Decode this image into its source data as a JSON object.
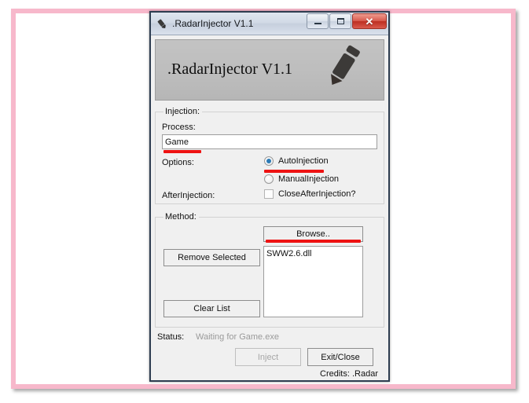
{
  "window": {
    "title": ".RadarInjector V1.1",
    "title_icon": "pencil-icon",
    "minimize_label": "–",
    "maximize_label": "□",
    "close_label": "✕"
  },
  "header": {
    "product_title": ".RadarInjector V1.1",
    "art": "pencil-illustration"
  },
  "injection_group": {
    "legend": "Injection:",
    "process_label": "Process:",
    "process_value": "Game",
    "process_placeholder": "",
    "options_label": "Options:",
    "radio_auto": "AutoInjection",
    "radio_manual": "ManualInjection",
    "radio_selected": "AutoInjection",
    "after_injection_label": "AfterInjection:",
    "checkbox_close": "CloseAfterInjection?",
    "checkbox_close_checked": false
  },
  "method_group": {
    "legend": "Method:",
    "browse_label": "Browse..",
    "remove_selected_label": "Remove Selected",
    "clear_list_label": "Clear List",
    "dll_list": [
      "SWW2.6.dll"
    ]
  },
  "footer": {
    "status_label": "Status:",
    "status_value": "Waiting for Game.exe",
    "inject_label": "Inject",
    "inject_enabled": false,
    "exit_label": "Exit/Close",
    "credits": "Credits: .Radar"
  },
  "annotations": {
    "color": "#ee1212",
    "marks": [
      "process-field",
      "auto-injection-radio",
      "browse-button"
    ]
  },
  "frame": {
    "border_color": "#f7b8cb"
  }
}
